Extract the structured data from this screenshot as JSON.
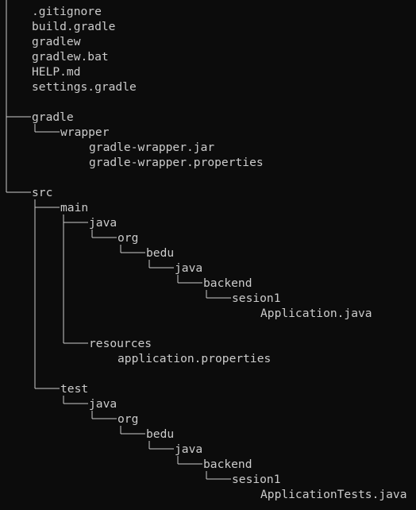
{
  "tree": {
    "entries": [
      {
        "name": ".gitignore",
        "depth": 0,
        "row": 0,
        "kind": "file"
      },
      {
        "name": "build.gradle",
        "depth": 0,
        "row": 1,
        "kind": "file"
      },
      {
        "name": "gradlew",
        "depth": 0,
        "row": 2,
        "kind": "file"
      },
      {
        "name": "gradlew.bat",
        "depth": 0,
        "row": 3,
        "kind": "file"
      },
      {
        "name": "HELP.md",
        "depth": 0,
        "row": 4,
        "kind": "file"
      },
      {
        "name": "settings.gradle",
        "depth": 0,
        "row": 5,
        "kind": "file"
      },
      {
        "name": "gradle",
        "depth": 0,
        "row": 7,
        "kind": "dir"
      },
      {
        "name": "wrapper",
        "depth": 1,
        "row": 8,
        "kind": "dir"
      },
      {
        "name": "gradle-wrapper.jar",
        "depth": 2,
        "row": 9,
        "kind": "file"
      },
      {
        "name": "gradle-wrapper.properties",
        "depth": 2,
        "row": 10,
        "kind": "file"
      },
      {
        "name": "src",
        "depth": 0,
        "row": 12,
        "kind": "dir"
      },
      {
        "name": "main",
        "depth": 1,
        "row": 13,
        "kind": "dir"
      },
      {
        "name": "java",
        "depth": 2,
        "row": 14,
        "kind": "dir"
      },
      {
        "name": "org",
        "depth": 3,
        "row": 15,
        "kind": "dir"
      },
      {
        "name": "bedu",
        "depth": 4,
        "row": 16,
        "kind": "dir"
      },
      {
        "name": "java",
        "depth": 5,
        "row": 17,
        "kind": "dir"
      },
      {
        "name": "backend",
        "depth": 6,
        "row": 18,
        "kind": "dir"
      },
      {
        "name": "sesion1",
        "depth": 7,
        "row": 19,
        "kind": "dir"
      },
      {
        "name": "Application.java",
        "depth": 8,
        "row": 20,
        "kind": "file"
      },
      {
        "name": "resources",
        "depth": 2,
        "row": 22,
        "kind": "dir"
      },
      {
        "name": "application.properties",
        "depth": 3,
        "row": 23,
        "kind": "file"
      },
      {
        "name": "test",
        "depth": 1,
        "row": 25,
        "kind": "dir"
      },
      {
        "name": "java",
        "depth": 2,
        "row": 26,
        "kind": "dir"
      },
      {
        "name": "org",
        "depth": 3,
        "row": 27,
        "kind": "dir"
      },
      {
        "name": "bedu",
        "depth": 4,
        "row": 28,
        "kind": "dir"
      },
      {
        "name": "java",
        "depth": 5,
        "row": 29,
        "kind": "dir"
      },
      {
        "name": "backend",
        "depth": 6,
        "row": 30,
        "kind": "dir"
      },
      {
        "name": "sesion1",
        "depth": 7,
        "row": 31,
        "kind": "dir"
      },
      {
        "name": "ApplicationTests.java",
        "depth": 8,
        "row": 32,
        "kind": "file"
      }
    ]
  },
  "colors": {
    "background": "#0c0c0c",
    "foreground": "#cccccc"
  }
}
